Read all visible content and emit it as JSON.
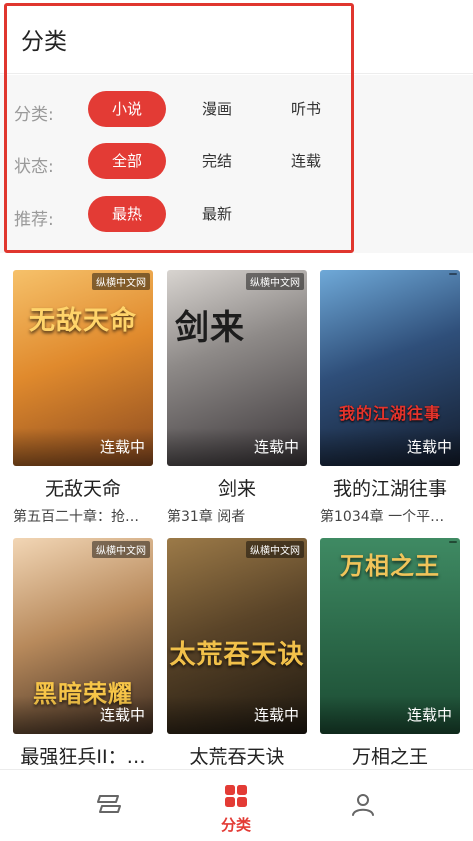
{
  "header": {
    "title": "分类"
  },
  "filters": {
    "rows": [
      {
        "label": "分类:",
        "options": [
          "小说",
          "漫画",
          "听书"
        ],
        "selected": "小说"
      },
      {
        "label": "状态:",
        "options": [
          "全部",
          "完结",
          "连载"
        ],
        "selected": "全部"
      },
      {
        "label": "推荐:",
        "options": [
          "最热",
          "最新"
        ],
        "selected": "最热"
      }
    ]
  },
  "books": [
    {
      "title": "无敌天命",
      "chapter": "第五百二十章：抢…",
      "status": "连载中",
      "cover_text": "无敌天命",
      "publisher": "纵横中文网",
      "accent": "#e8a033"
    },
    {
      "title": "剑来",
      "chapter": "第31章 阅者",
      "status": "连载中",
      "cover_text": "剑来",
      "publisher": "纵横中文网",
      "accent": "#8a8f9a"
    },
    {
      "title": "我的江湖往事",
      "chapter": "第1034章 一个平…",
      "status": "连载中",
      "cover_text": "我的江湖往事",
      "publisher": "",
      "accent": "#2b4a78"
    },
    {
      "title": "最强狂兵II：…",
      "chapter": "",
      "status": "连载中",
      "cover_text": "黑暗荣耀",
      "publisher": "纵横中文网",
      "accent": "#c48a4a"
    },
    {
      "title": "太荒吞天诀",
      "chapter": "",
      "status": "连载中",
      "cover_text": "太荒吞天诀",
      "publisher": "纵横中文网",
      "accent": "#6b5a3a"
    },
    {
      "title": "万相之王",
      "chapter": "",
      "status": "连载中",
      "cover_text": "万相之王",
      "publisher": "",
      "accent": "#2f6b4a"
    }
  ],
  "tabbar": {
    "active_label": "分类",
    "active_color": "#e33b35"
  },
  "colors": {
    "accent": "#e33b35",
    "highlight": "#e0362e"
  }
}
